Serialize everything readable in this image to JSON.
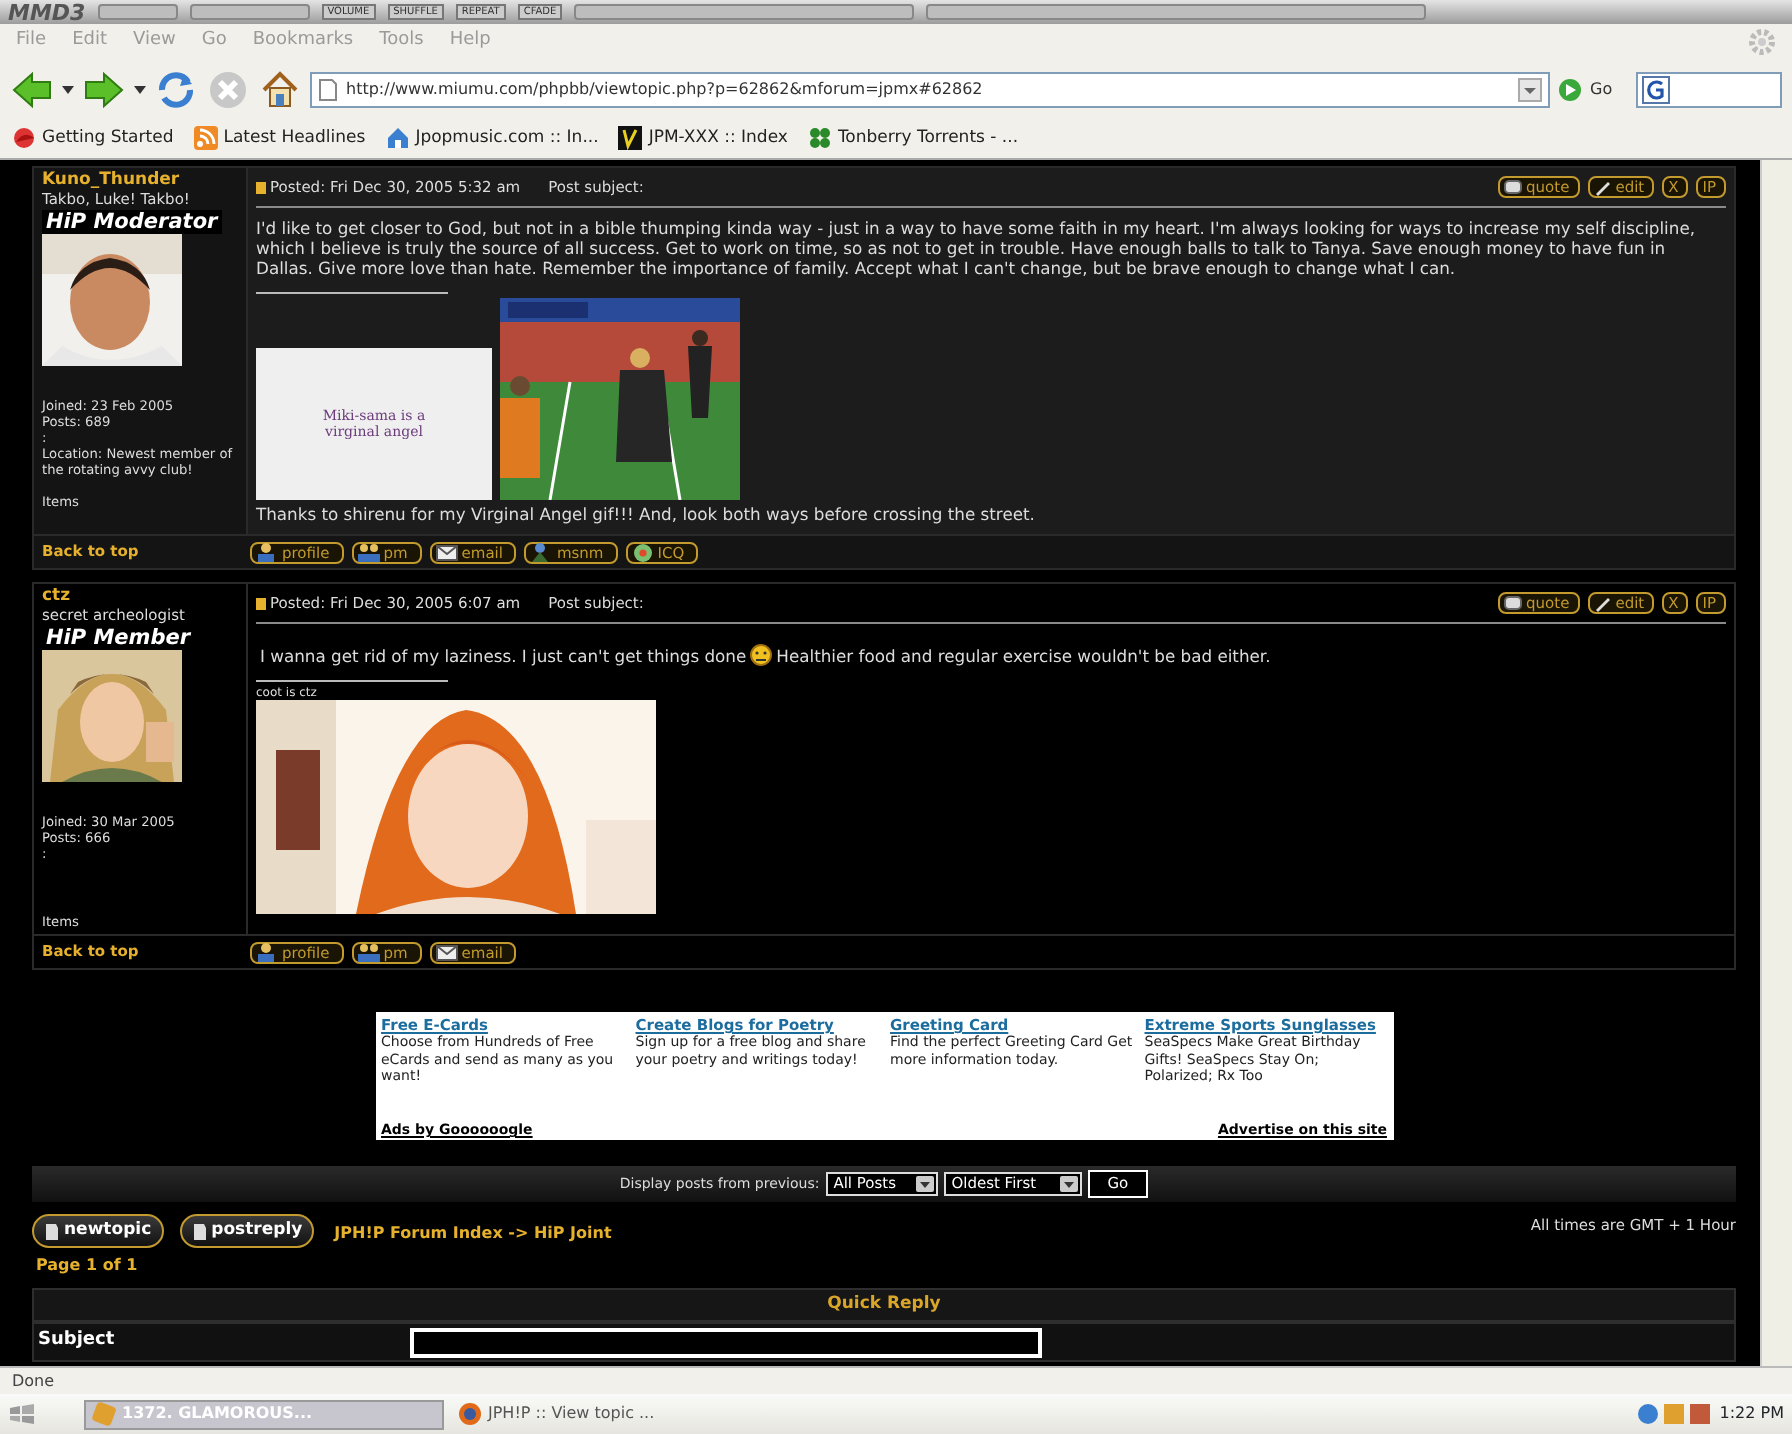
{
  "media_player": {
    "logo": "MMD3",
    "labels": [
      "VOLUME",
      "SHUFFLE",
      "REPEAT",
      "CFADE"
    ]
  },
  "menu": [
    "File",
    "Edit",
    "View",
    "Go",
    "Bookmarks",
    "Tools",
    "Help"
  ],
  "toolbar": {
    "address": "http://www.miumu.com/phpbb/viewtopic.php?p=62862&mforum=jpmx#62862",
    "go": "Go"
  },
  "bookmarks": [
    {
      "label": "Getting Started",
      "kind": "firefox"
    },
    {
      "label": "Latest Headlines",
      "kind": "rss"
    },
    {
      "label": "Jpopmusic.com :: In...",
      "kind": "house"
    },
    {
      "label": "JPM-XXX :: Index",
      "kind": "jpm"
    },
    {
      "label": "Tonberry Torrents - ...",
      "kind": "clover"
    }
  ],
  "posts": [
    {
      "author": "Kuno_Thunder",
      "rank_title": "Takbo, Luke! Takbo!",
      "rank_badge": "HiP Moderator",
      "avatar": {
        "kind": "picture"
      },
      "details": [
        "Joined: 23 Feb 2005",
        "Posts: 689",
        ":",
        "Location: Newest member of the rotating avvy club!"
      ],
      "items": "Items",
      "posted": "Posted: Fri Dec 30, 2005 5:32 am",
      "subject_label": "Post subject:",
      "actions": [
        "quote",
        "edit",
        "X",
        "IP"
      ],
      "body": [
        "I'd like to get closer to God, but not in a bible thumping kinda way - just in a way to have some faith in my heart. I'm always looking for ways to increase my self discipline, which I believe is truly the source of all success. Get to work on time, so as not to get in trouble. Have enough balls to talk to Tanya. Save enough money to have fun in Dallas. Give more love than hate. Remember the importance of family. Accept what I can't change, but be brave enough to change what I can."
      ],
      "signature": {
        "images": [
          {
            "kind": "text_image",
            "text": "Miki-sama is a virginal angel"
          },
          {
            "kind": "picture"
          }
        ],
        "text": "Thanks to shirenu for my Virginal Angel gif!!! And, look both ways before crossing the street."
      },
      "back_to_top": "Back to top",
      "contacts": [
        {
          "label": "profile",
          "kind": "profile"
        },
        {
          "label": "pm",
          "kind": "pm"
        },
        {
          "label": "email",
          "kind": "email"
        },
        {
          "label": "msnm",
          "kind": "msnm"
        },
        {
          "label": "ICQ",
          "kind": "icq"
        }
      ]
    },
    {
      "author": "ctz",
      "rank_title": "secret archeologist",
      "rank_badge": "HiP Member",
      "avatar": {
        "kind": "picture"
      },
      "details": [
        "Joined: 30 Mar 2005",
        "Posts: 666",
        ":"
      ],
      "items": "Items",
      "posted": "Posted: Fri Dec 30, 2005 6:07 am",
      "subject_label": "Post subject:",
      "actions": [
        "quote",
        "edit",
        "X",
        "IP"
      ],
      "body": [
        "I wanna get rid of my laziness. I just can't get things done",
        "Healthier food and regular exercise wouldn't be bad either."
      ],
      "signature": {
        "caption": "coot is ctz",
        "images": [
          {
            "kind": "picture"
          }
        ]
      },
      "back_to_top": "Back to top",
      "contacts": [
        {
          "label": "profile",
          "kind": "profile"
        },
        {
          "label": "pm",
          "kind": "pm"
        },
        {
          "label": "email",
          "kind": "email"
        }
      ]
    }
  ],
  "ads": {
    "items": [
      {
        "title": "Free E-Cards",
        "text": "Choose from Hundreds of Free eCards and send as many as you want!"
      },
      {
        "title": "Create Blogs for Poetry",
        "text": "Sign up for a free blog and share your poetry and writings today!"
      },
      {
        "title": "Greeting Card",
        "text": "Find the perfect Greeting Card Get more information today."
      },
      {
        "title": "Extreme Sports Sunglasses",
        "text": "SeaSpecs Make Great Birthday Gifts! SeaSpecs Stay On; Polarized; Rx Too"
      }
    ],
    "by": "Ads by Goooooogle",
    "advertise": "Advertise on this site"
  },
  "display": {
    "label": "Display posts from previous:",
    "range": "All Posts",
    "order": "Oldest First",
    "go": "Go"
  },
  "nav": {
    "new_topic": "newtopic",
    "post_reply": "postreply",
    "breadcrumb": "JPH!P Forum Index -> HiP Joint",
    "timezone": "All times are GMT + 1 Hour",
    "page": "Page 1 of 1"
  },
  "quick_reply": {
    "title": "Quick Reply",
    "subject_label": "Subject"
  },
  "status": "Done",
  "taskbar": {
    "items": [
      {
        "label": "1372. GLAMOROUS...",
        "selected": true
      },
      {
        "label": "JPH!P :: View topic ...",
        "selected": false
      }
    ],
    "clock": "1:22 PM"
  }
}
